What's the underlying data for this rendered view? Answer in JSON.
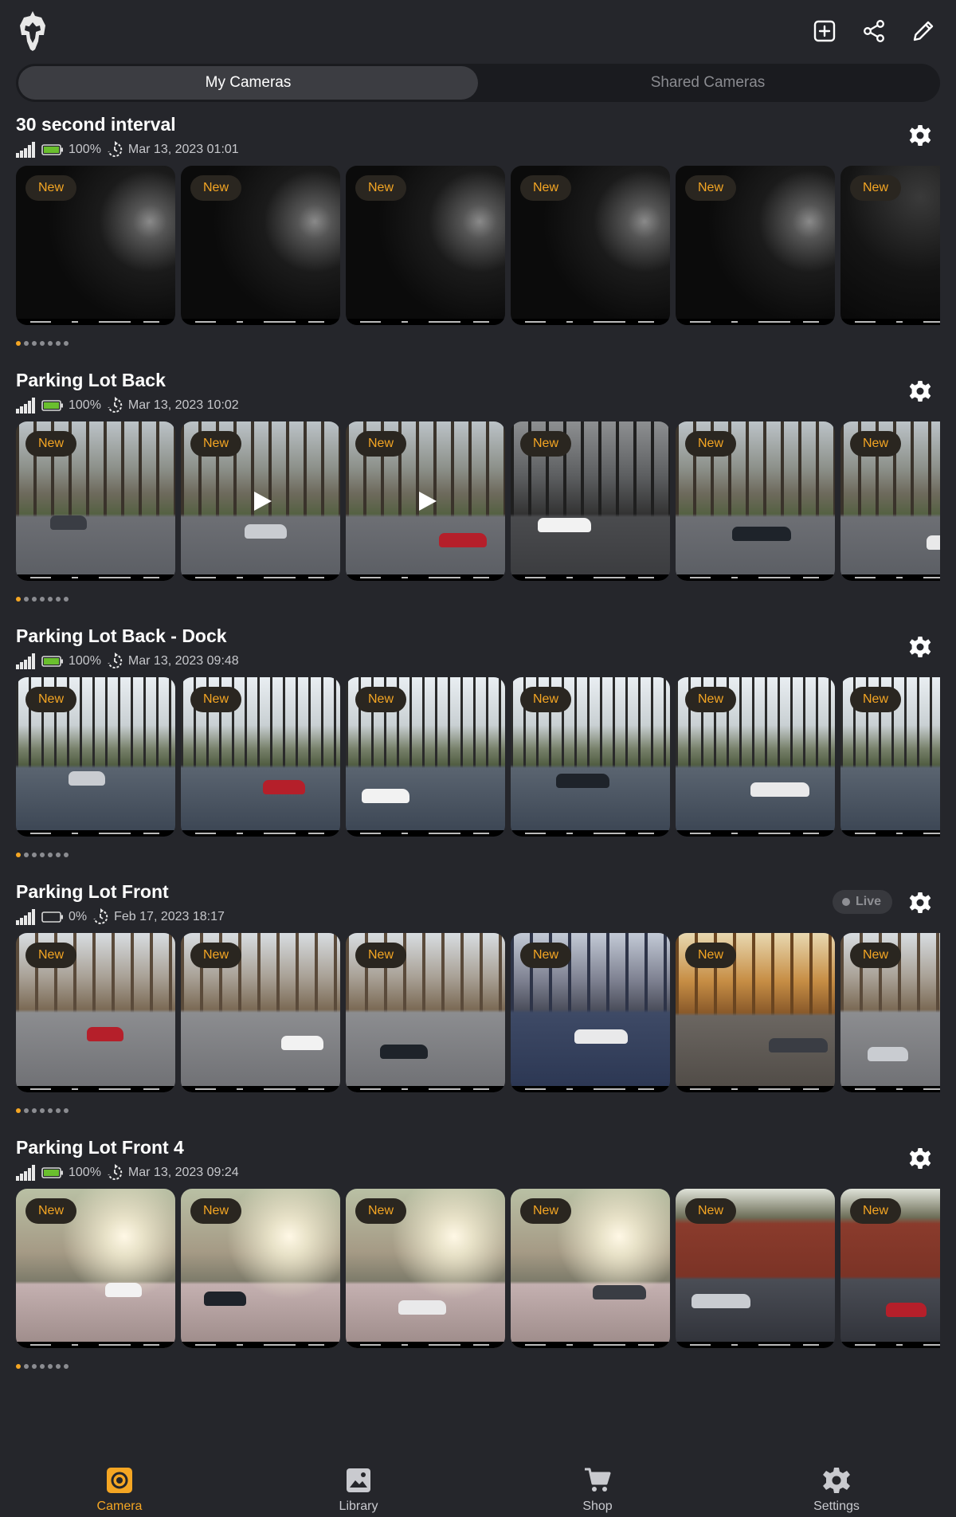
{
  "header": {
    "tabs": [
      {
        "label": "My Cameras",
        "active": true
      },
      {
        "label": "Shared Cameras",
        "active": false
      }
    ],
    "actions": [
      "add-square-icon",
      "share-icon",
      "edit-pencil-icon"
    ]
  },
  "colors": {
    "accent": "#f5a623",
    "background": "#25262b",
    "battery": "#6abf2e"
  },
  "cameras": [
    {
      "name": "30 second interval",
      "battery": "100%",
      "last_sync": "Mar 13, 2023 01:01",
      "battery_level": 1.0,
      "live": false,
      "scene": "night",
      "thumbnails": [
        {
          "badge": "New"
        },
        {
          "badge": "New"
        },
        {
          "badge": "New"
        },
        {
          "badge": "New"
        },
        {
          "badge": "New"
        },
        {
          "badge": "New"
        }
      ]
    },
    {
      "name": "Parking Lot Back",
      "battery": "100%",
      "last_sync": "Mar 13, 2023 10:02",
      "battery_level": 1.0,
      "live": false,
      "scene": "park",
      "thumbnails": [
        {
          "badge": "New"
        },
        {
          "badge": "New",
          "video": true
        },
        {
          "badge": "New",
          "video": true
        },
        {
          "badge": "New"
        },
        {
          "badge": "New"
        },
        {
          "badge": "New"
        }
      ]
    },
    {
      "name": "Parking Lot Back - Dock",
      "battery": "100%",
      "last_sync": "Mar 13, 2023 09:48",
      "battery_level": 1.0,
      "live": false,
      "scene": "dock",
      "thumbnails": [
        {
          "badge": "New"
        },
        {
          "badge": "New"
        },
        {
          "badge": "New"
        },
        {
          "badge": "New"
        },
        {
          "badge": "New"
        },
        {
          "badge": "New"
        }
      ]
    },
    {
      "name": "Parking Lot Front",
      "battery": "0%",
      "last_sync": "Feb 17, 2023 18:17",
      "battery_level": 0.0,
      "live": true,
      "live_label": "Live",
      "scene": "front",
      "thumbnails": [
        {
          "badge": "New"
        },
        {
          "badge": "New"
        },
        {
          "badge": "New"
        },
        {
          "badge": "New"
        },
        {
          "badge": "New"
        },
        {
          "badge": "New"
        }
      ]
    },
    {
      "name": "Parking Lot Front 4",
      "battery": "100%",
      "last_sync": "Mar 13, 2023 09:24",
      "battery_level": 1.0,
      "live": false,
      "scene": "haze",
      "thumbnails": [
        {
          "badge": "New"
        },
        {
          "badge": "New"
        },
        {
          "badge": "New"
        },
        {
          "badge": "New"
        },
        {
          "badge": "New"
        },
        {
          "badge": "New"
        }
      ]
    }
  ],
  "bottom_nav": [
    {
      "label": "Camera",
      "icon": "camera-icon",
      "active": true
    },
    {
      "label": "Library",
      "icon": "library-icon",
      "active": false
    },
    {
      "label": "Shop",
      "icon": "cart-icon",
      "active": false
    },
    {
      "label": "Settings",
      "icon": "gear-icon",
      "active": false
    }
  ]
}
